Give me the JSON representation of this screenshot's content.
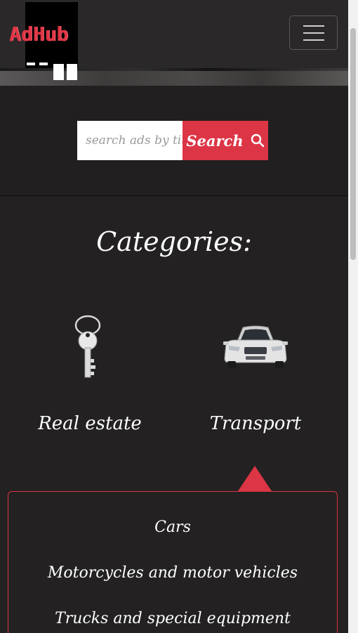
{
  "header": {
    "logo_text": "AdHub",
    "menu_icon": "hamburger-menu-icon"
  },
  "search": {
    "placeholder": "search ads by title",
    "button_label": "Search",
    "button_icon": "search-icon"
  },
  "categories": {
    "title": "Categories:",
    "items": [
      {
        "label": "Real estate",
        "icon": "key-icon"
      },
      {
        "label": "Transport",
        "icon": "car-icon"
      }
    ]
  },
  "subcategories": {
    "items": [
      {
        "label": "Cars"
      },
      {
        "label": "Motorcycles and motor vehicles"
      },
      {
        "label": "Trucks and special equipment"
      }
    ]
  },
  "colors": {
    "accent": "#dc3545",
    "background": "#232121",
    "header": "#2a2828"
  }
}
